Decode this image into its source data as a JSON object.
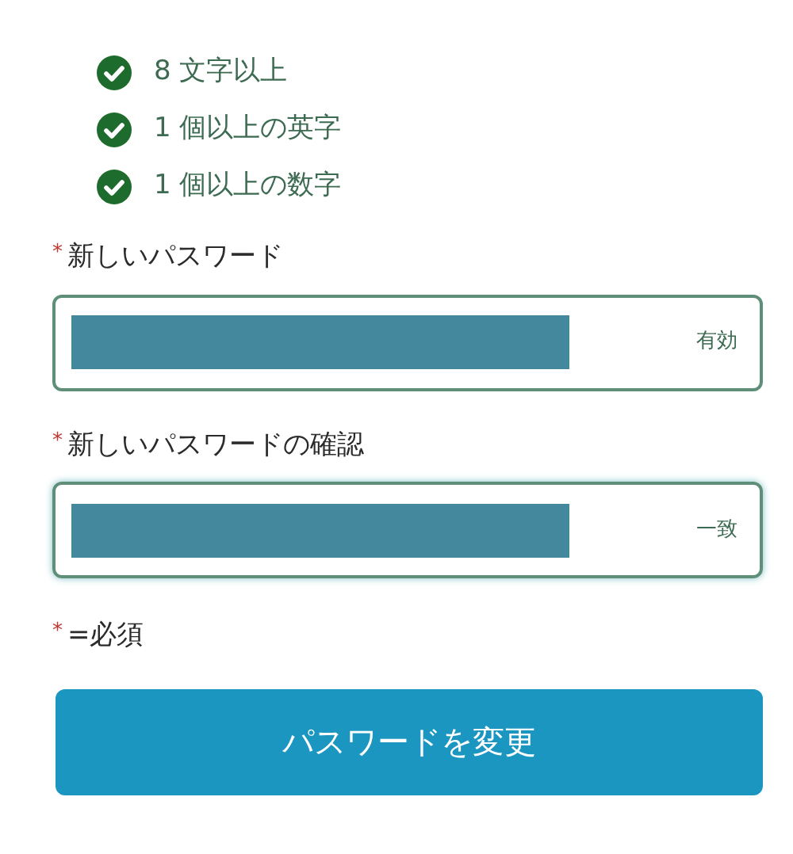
{
  "requirements": [
    {
      "text": "8 文字以上",
      "met": true
    },
    {
      "text": "1 個以上の英字",
      "met": true
    },
    {
      "text": "1 個以上の数字",
      "met": true
    }
  ],
  "fields": [
    {
      "asterisk": "*",
      "label": "新しいパスワード",
      "status": "有効",
      "focused": false
    },
    {
      "asterisk": "*",
      "label": "新しいパスワードの確認",
      "status": "一致",
      "focused": true
    }
  ],
  "legend": {
    "asterisk": "*",
    "text": "=必須"
  },
  "submit_button": "パスワードを変更"
}
